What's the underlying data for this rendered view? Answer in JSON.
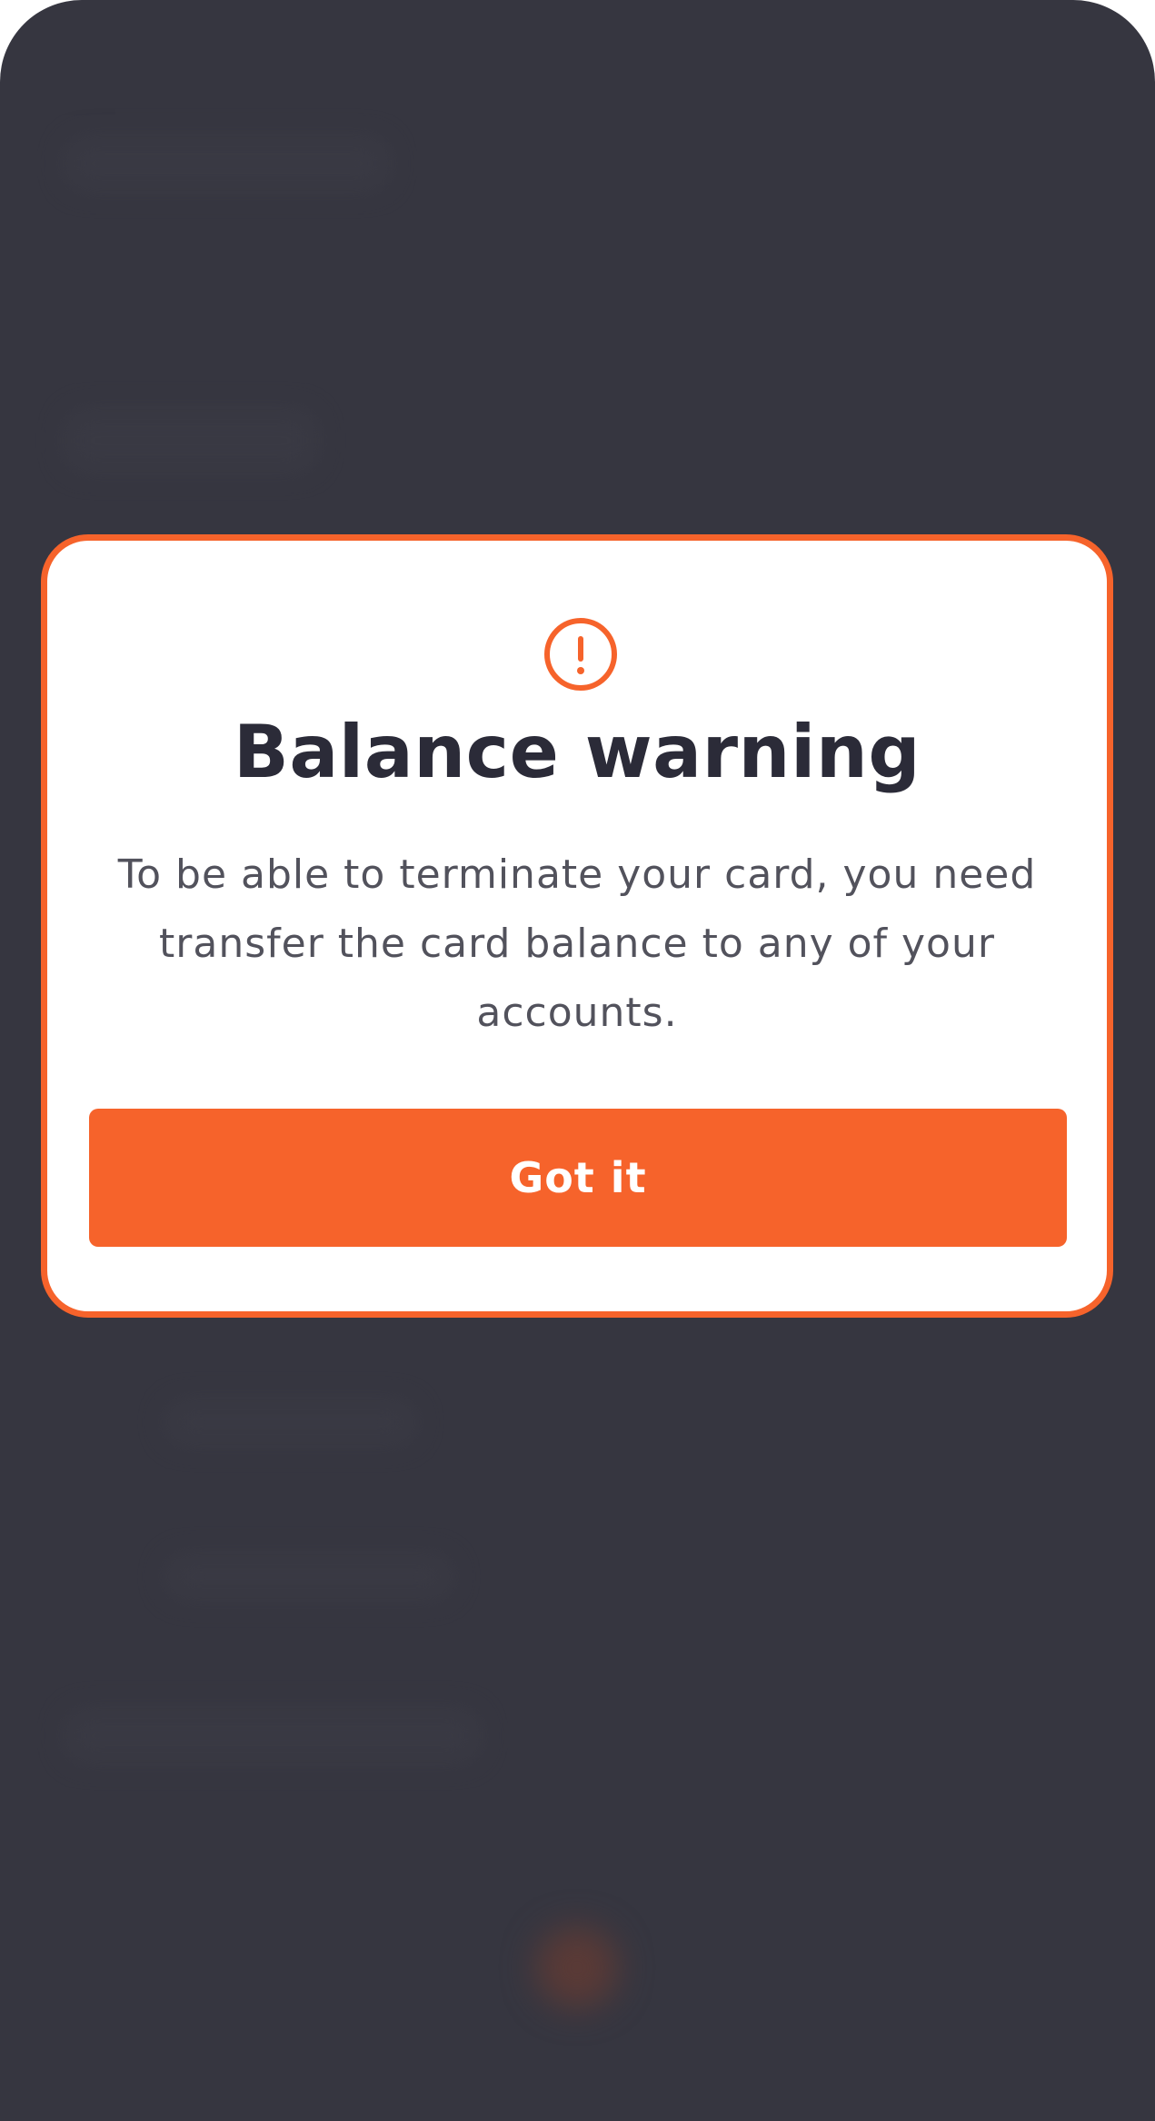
{
  "dialog": {
    "title": "Balance warning",
    "message": "To be able to terminate your card, you need transfer the card balance to any of your accounts.",
    "button_label": "Got it",
    "icon": "warning-icon"
  },
  "colors": {
    "accent": "#f6632b",
    "overlay": "#363640",
    "title": "#2b2b38",
    "body_text": "#52525c"
  }
}
